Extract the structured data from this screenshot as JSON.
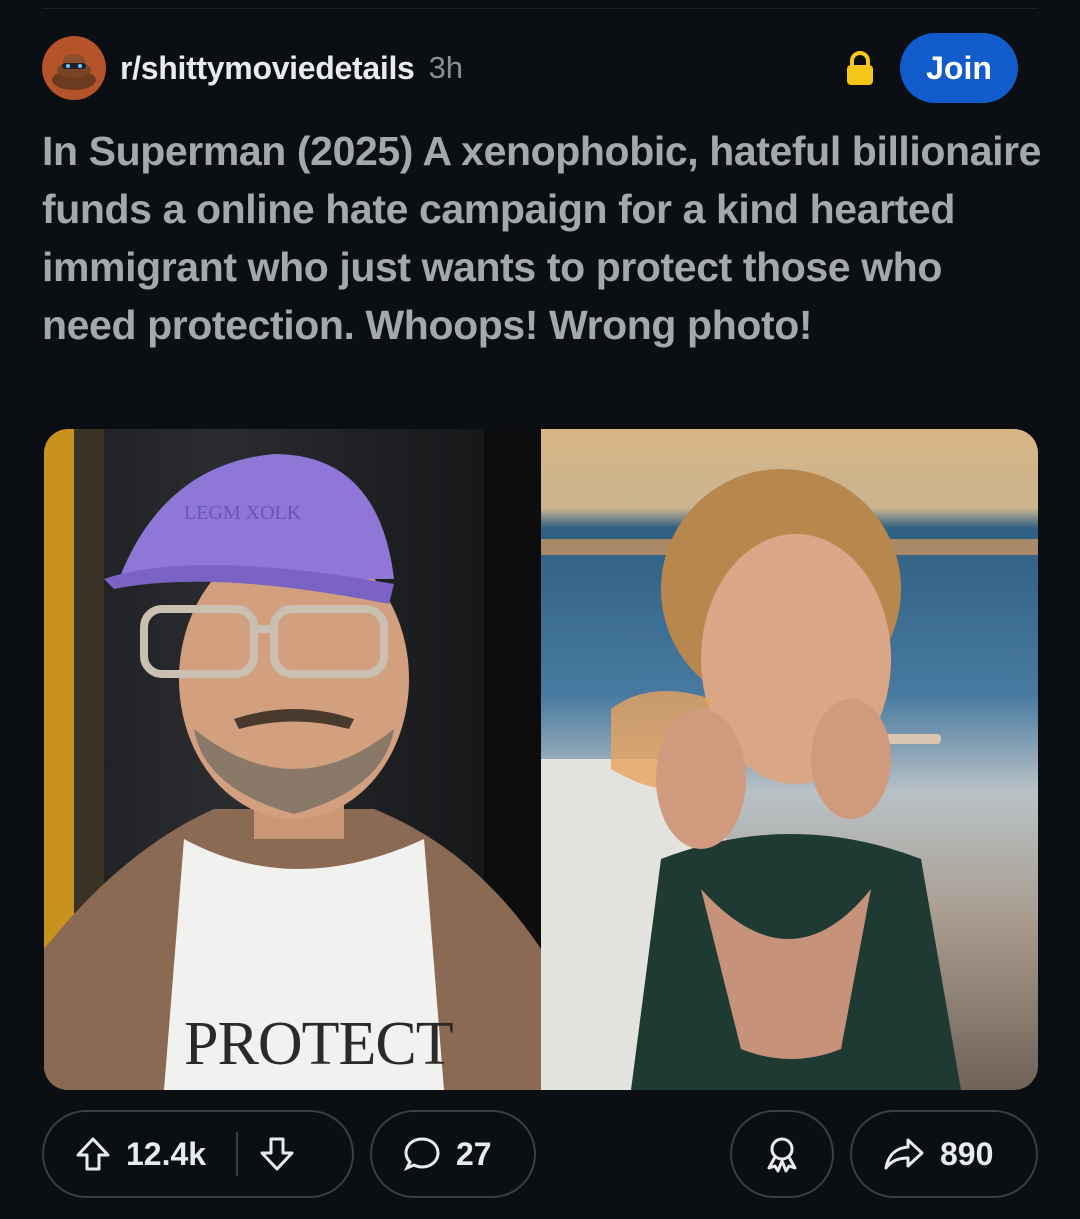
{
  "post": {
    "subreddit": "r/shittymoviedetails",
    "age": "3h",
    "join_label": "Join",
    "title": "In Superman (2025) A xenophobic, hateful billionaire funds a online hate campaign for a kind hearted immigrant who just wants to protect those who need protection. Whoops! Wrong photo!",
    "image_left_shirt_text": "PROTECT",
    "image_left_cap_text": "LEGM XOLK"
  },
  "actions": {
    "upvotes": "12.4k",
    "comments": "27",
    "shares": "890"
  },
  "colors": {
    "background": "#0b0e12",
    "join_button": "#115bca",
    "lock": "#f5c518",
    "title_text": "#a4a8ac"
  }
}
